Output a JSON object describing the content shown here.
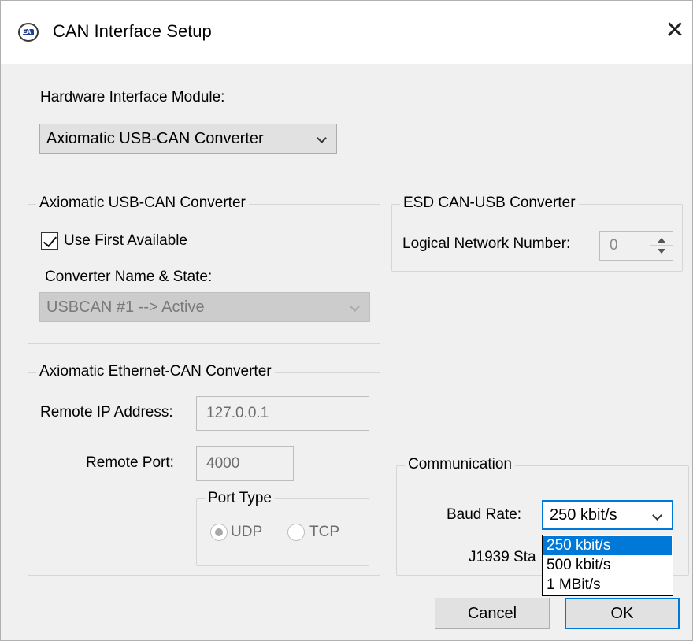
{
  "window": {
    "title": "CAN Interface Setup",
    "close_glyph": "✕",
    "icon_text": "EA"
  },
  "hardware": {
    "label": "Hardware Interface Module:",
    "selected": "Axiomatic USB-CAN Converter"
  },
  "usb_can": {
    "group_title": "Axiomatic USB-CAN Converter",
    "use_first_label": "Use First Available",
    "use_first_checked": true,
    "converter_label": "Converter Name & State:",
    "converter_value": "USBCAN #1  --> Active"
  },
  "esd": {
    "group_title": "ESD CAN-USB Converter",
    "network_label": "Logical Network Number:",
    "network_value": "0"
  },
  "ethernet": {
    "group_title": "Axiomatic Ethernet-CAN Converter",
    "ip_label": "Remote IP Address:",
    "ip_value": "127.0.0.1",
    "port_label": "Remote Port:",
    "port_value": "4000",
    "port_type_title": "Port Type",
    "udp_label": "UDP",
    "tcp_label": "TCP",
    "selected_port_type": "UDP"
  },
  "communication": {
    "group_title": "Communication",
    "baud_label": "Baud Rate:",
    "baud_value": "250 kbit/s",
    "j1939_label": "J1939 Sta",
    "options": [
      "250 kbit/s",
      "500 kbit/s",
      "1 MBit/s"
    ],
    "selected_option": "250 kbit/s"
  },
  "buttons": {
    "cancel": "Cancel",
    "ok": "OK"
  },
  "colors": {
    "accent": "#0078d7",
    "face": "#f0f0f0",
    "button": "#e1e1e1"
  }
}
